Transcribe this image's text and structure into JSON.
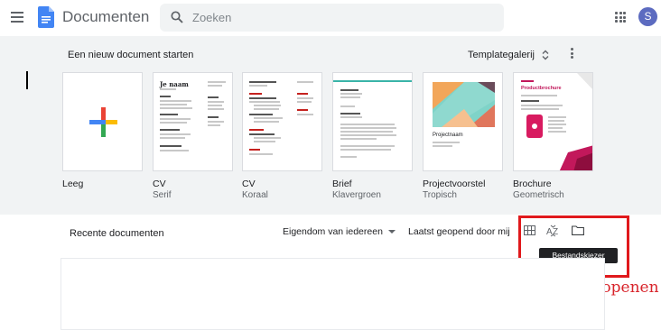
{
  "header": {
    "app_title": "Documenten",
    "search_placeholder": "Zoeken",
    "avatar_initial": "S",
    "icons": {
      "menu": "hamburger-menu-icon",
      "logo": "google-docs-logo",
      "search": "search-icon",
      "apps": "apps-grid-icon"
    }
  },
  "templates": {
    "heading": "Een nieuw document starten",
    "gallery_label": "Templategalerij",
    "cards": [
      {
        "name": "Leeg",
        "sub": ""
      },
      {
        "name": "CV",
        "sub": "Serif"
      },
      {
        "name": "CV",
        "sub": "Koraal"
      },
      {
        "name": "Brief",
        "sub": "Klavergroen"
      },
      {
        "name": "Projectvoorstel",
        "sub": "Tropisch"
      },
      {
        "name": "Brochure",
        "sub": "Geometrisch"
      }
    ],
    "thumb_text": {
      "cv_serif_name": "Je naam",
      "project_title": "Projectnaam",
      "brochure_title": "Productbrochure"
    }
  },
  "recent": {
    "label": "Recente documenten",
    "owner_filter": "Eigendom van iedereen",
    "sort_label": "Laatst geopend door mij",
    "tooltip": "Bestandskiezer openen",
    "callout": "Bestandkiezer openen"
  },
  "colors": {
    "accent_blue": "#4285f4",
    "highlight_red": "#e0191c",
    "avatar": "#5c6bc0"
  }
}
